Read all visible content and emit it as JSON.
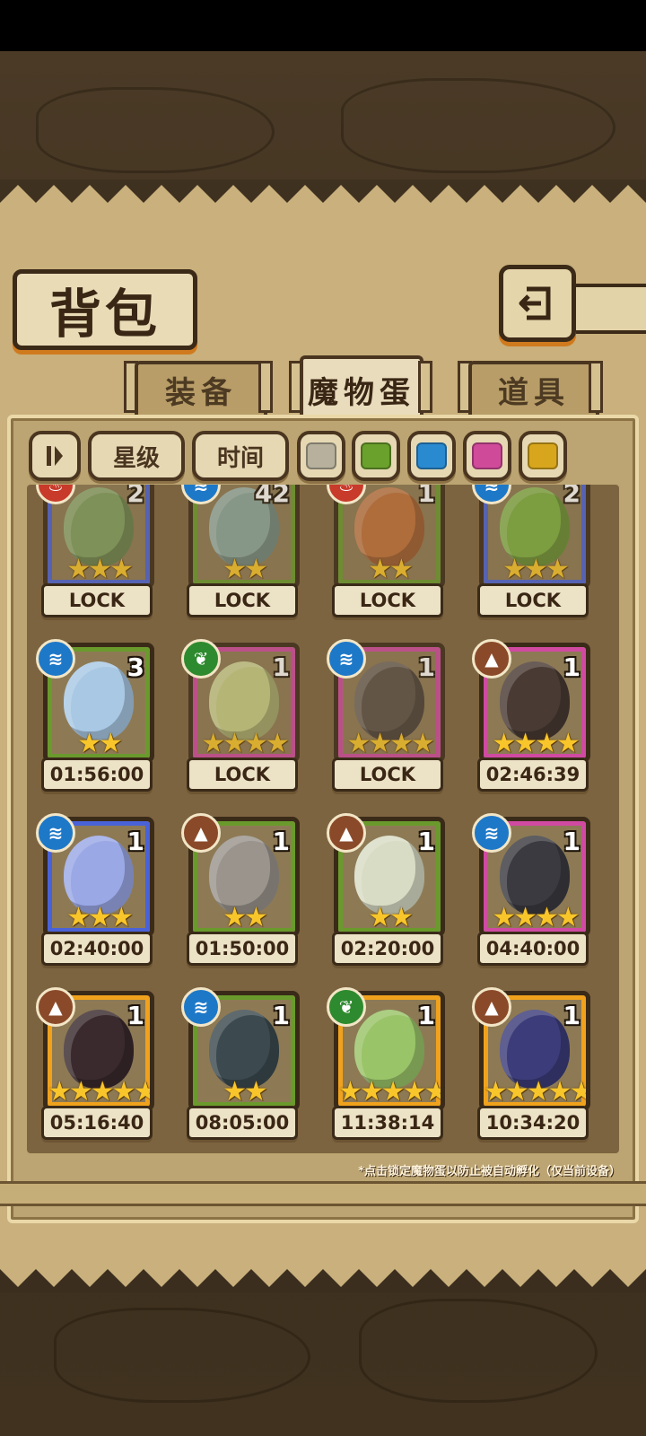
{
  "title": "背包",
  "tabs": [
    {
      "label": "装备",
      "active": false
    },
    {
      "label": "魔物蛋",
      "active": true
    },
    {
      "label": "道具",
      "active": false
    }
  ],
  "filters": {
    "sort_icon": "sort-toggle-icon",
    "star_label": "星级",
    "time_label": "时间",
    "colors": [
      "#b7b09c",
      "#6aa02c",
      "#2a8ad0",
      "#d04a9a",
      "#d8a61c"
    ]
  },
  "eggs": [
    {
      "count": "2",
      "stars": "★★★",
      "label": "LOCK",
      "rarity": "blue",
      "element": "fire",
      "egg_color": "#7fa060"
    },
    {
      "count": "42",
      "stars": "★★",
      "label": "LOCK",
      "rarity": "green",
      "element": "water",
      "egg_color": "#8aa8a0"
    },
    {
      "count": "1",
      "stars": "★★",
      "label": "LOCK",
      "rarity": "green",
      "element": "fire",
      "egg_color": "#c0703a"
    },
    {
      "count": "2",
      "stars": "★★★",
      "label": "LOCK",
      "rarity": "blue",
      "element": "water",
      "egg_color": "#7cb040"
    },
    {
      "count": "3",
      "stars": "★★",
      "label": "01:56:00",
      "rarity": "green",
      "element": "water",
      "egg_color": "#a9c8e4"
    },
    {
      "count": "1",
      "stars": "★★★★",
      "label": "LOCK",
      "rarity": "pink",
      "element": "nature",
      "egg_color": "#c8d088"
    },
    {
      "count": "1",
      "stars": "★★★★",
      "label": "LOCK",
      "rarity": "pink",
      "element": "water",
      "egg_color": "#5a5048"
    },
    {
      "count": "1",
      "stars": "★★★★",
      "label": "02:46:39",
      "rarity": "pink",
      "element": "earth",
      "egg_color": "#4a3a34"
    },
    {
      "count": "1",
      "stars": "★★★",
      "label": "02:40:00",
      "rarity": "blue",
      "element": "water",
      "egg_color": "#9aa8e6"
    },
    {
      "count": "1",
      "stars": "★★",
      "label": "01:50:00",
      "rarity": "green",
      "element": "earth",
      "egg_color": "#9a948c"
    },
    {
      "count": "1",
      "stars": "★★",
      "label": "02:20:00",
      "rarity": "green",
      "element": "earth",
      "egg_color": "#d8dcc4"
    },
    {
      "count": "1",
      "stars": "★★★★",
      "label": "04:40:00",
      "rarity": "pink",
      "element": "water",
      "egg_color": "#3a3a40"
    },
    {
      "count": "1",
      "stars": "★★★★★",
      "label": "05:16:40",
      "rarity": "gold",
      "element": "earth",
      "egg_color": "#3a2a2e"
    },
    {
      "count": "1",
      "stars": "★★",
      "label": "08:05:00",
      "rarity": "green",
      "element": "water",
      "egg_color": "#3c4a50"
    },
    {
      "count": "1",
      "stars": "★★★★★",
      "label": "11:38:14",
      "rarity": "gold",
      "element": "nature",
      "egg_color": "#9ac468"
    },
    {
      "count": "1",
      "stars": "★★★★★",
      "label": "10:34:20",
      "rarity": "gold",
      "element": "earth",
      "egg_color": "#3c3c7a"
    }
  ],
  "footnote": "*点击锁定魔物蛋以防止被自动孵化（仅当前设备）",
  "rarity_colors": {
    "blue": "#4a62d8",
    "green": "#6a9a2c",
    "pink": "#d04aa2",
    "gold": "#f0a21c"
  },
  "element_colors": {
    "fire": "#c83a2a",
    "water": "#1e78c8",
    "nature": "#2e8a2e",
    "earth": "#8a4a2a"
  }
}
